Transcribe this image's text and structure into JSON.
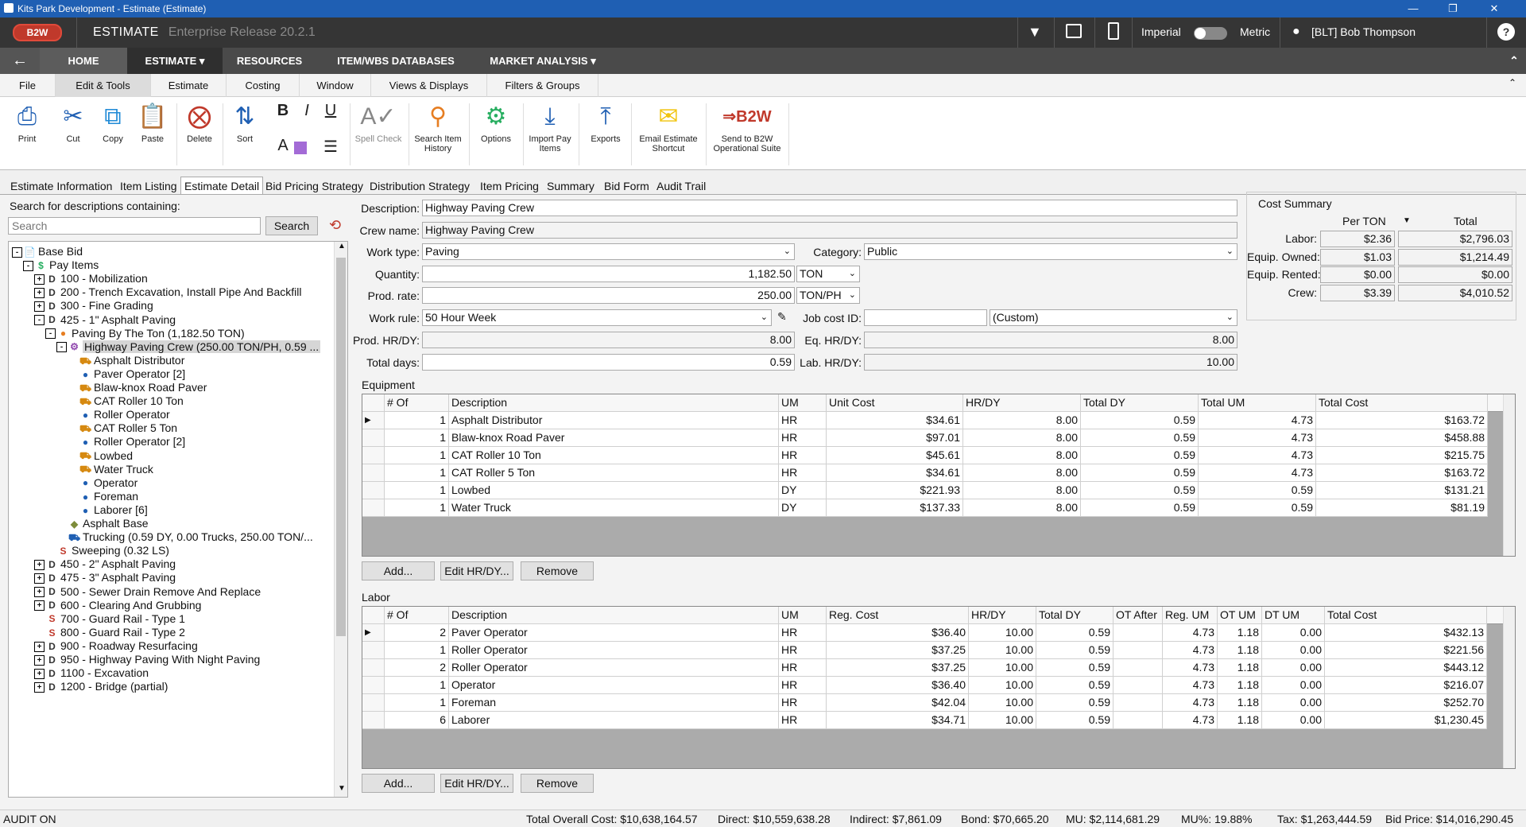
{
  "window": {
    "title": "Kits Park Development - Estimate (Estimate)"
  },
  "appbar": {
    "logo": "B2W",
    "app_name": "ESTIMATE",
    "release": "Enterprise Release 20.2.1",
    "imperial": "Imperial",
    "metric": "Metric",
    "user": "[BLT] Bob Thompson",
    "help": "?"
  },
  "mainnav": {
    "home": "HOME",
    "estimate": "ESTIMATE",
    "resources": "RESOURCES",
    "item_wbs": "ITEM/WBS DATABASES",
    "market": "MARKET ANALYSIS"
  },
  "ribbon_tabs": [
    "File",
    "Edit & Tools",
    "Estimate",
    "Costing",
    "Window",
    "Views & Displays",
    "Filters & Groups"
  ],
  "ribbon": {
    "print": "Print",
    "cut": "Cut",
    "copy": "Copy",
    "paste": "Paste",
    "delete": "Delete",
    "sort": "Sort",
    "bold": "B",
    "italic": "I",
    "underline": "U",
    "font_a": "A",
    "spell": "Spell Check",
    "search_hist": "Search Item History",
    "options": "Options",
    "import_pay": "Import Pay Items",
    "exports": "Exports",
    "email": "Email Estimate Shortcut",
    "send": "Send to B2W Operational Suite"
  },
  "content_tabs": [
    "Estimate Information",
    "Item Listing",
    "Estimate Detail",
    "Bid Pricing Strategy",
    "Distribution Strategy",
    "Item Pricing",
    "Summary",
    "Bid Form",
    "Audit Trail"
  ],
  "search": {
    "label": "Search for descriptions containing:",
    "placeholder": "Search",
    "button": "Search"
  },
  "tree": [
    {
      "t": "Base Bid",
      "lvl": 0,
      "box": "-",
      "icon": "doc"
    },
    {
      "t": "Pay Items",
      "lvl": 1,
      "box": "-",
      "icon": "$"
    },
    {
      "t": "100 - Mobilization",
      "lvl": 2,
      "box": "+",
      "icon": "D"
    },
    {
      "t": "200 - Trench Excavation, Install Pipe And Backfill",
      "lvl": 2,
      "box": "+",
      "icon": "D"
    },
    {
      "t": "300 - Fine Grading",
      "lvl": 2,
      "box": "+",
      "icon": "D"
    },
    {
      "t": "425 - 1\" Asphalt Paving",
      "lvl": 2,
      "box": "-",
      "icon": "D"
    },
    {
      "t": "Paving By The Ton (1,182.50 TON)",
      "lvl": 3,
      "box": "-",
      "icon": "O"
    },
    {
      "t": "Highway Paving Crew (250.00 TON/PH, 0.59 ...",
      "lvl": 4,
      "box": "-",
      "icon": "crew",
      "sel": true
    },
    {
      "t": "Asphalt Distributor",
      "lvl": 5,
      "icon": "eq"
    },
    {
      "t": "Paver Operator [2]",
      "lvl": 5,
      "icon": "per"
    },
    {
      "t": "Blaw-knox Road Paver",
      "lvl": 5,
      "icon": "eq"
    },
    {
      "t": "CAT Roller 10 Ton",
      "lvl": 5,
      "icon": "eq"
    },
    {
      "t": "Roller Operator",
      "lvl": 5,
      "icon": "per"
    },
    {
      "t": "CAT Roller 5 Ton",
      "lvl": 5,
      "icon": "eq"
    },
    {
      "t": "Roller Operator [2]",
      "lvl": 5,
      "icon": "per"
    },
    {
      "t": "Lowbed",
      "lvl": 5,
      "icon": "eq"
    },
    {
      "t": "Water Truck",
      "lvl": 5,
      "icon": "eq"
    },
    {
      "t": "Operator",
      "lvl": 5,
      "icon": "per"
    },
    {
      "t": "Foreman",
      "lvl": 5,
      "icon": "per"
    },
    {
      "t": "Laborer [6]",
      "lvl": 5,
      "icon": "per"
    },
    {
      "t": "Asphalt Base",
      "lvl": 4,
      "icon": "mat"
    },
    {
      "t": "Trucking (0.59 DY, 0.00 Trucks, 250.00 TON/...",
      "lvl": 4,
      "icon": "trk"
    },
    {
      "t": "Sweeping (0.32 LS)",
      "lvl": 3,
      "icon": "S"
    },
    {
      "t": "450 - 2\" Asphalt Paving",
      "lvl": 2,
      "box": "+",
      "icon": "D"
    },
    {
      "t": "475 - 3\" Asphalt Paving",
      "lvl": 2,
      "box": "+",
      "icon": "D"
    },
    {
      "t": "500 - Sewer Drain Remove And Replace",
      "lvl": 2,
      "box": "+",
      "icon": "D"
    },
    {
      "t": "600 - Clearing And Grubbing",
      "lvl": 2,
      "box": "+",
      "icon": "D"
    },
    {
      "t": "700 - Guard Rail - Type 1",
      "lvl": 2,
      "icon": "S"
    },
    {
      "t": "800 - Guard Rail - Type 2",
      "lvl": 2,
      "icon": "S"
    },
    {
      "t": "900 - Roadway Resurfacing",
      "lvl": 2,
      "box": "+",
      "icon": "D"
    },
    {
      "t": "950 - Highway Paving With Night Paving",
      "lvl": 2,
      "box": "+",
      "icon": "D"
    },
    {
      "t": "1100 - Excavation",
      "lvl": 2,
      "box": "+",
      "icon": "D"
    },
    {
      "t": "1200 - Bridge (partial)",
      "lvl": 2,
      "box": "+",
      "icon": "D"
    }
  ],
  "form": {
    "description_label": "Description:",
    "description": "Highway Paving Crew",
    "crew_label": "Crew name:",
    "crew": "Highway Paving Crew",
    "worktype_label": "Work type:",
    "worktype": "Paving",
    "category_label": "Category:",
    "category": "Public",
    "quantity_label": "Quantity:",
    "quantity": "1,182.50",
    "quantity_um": "TON",
    "prodrate_label": "Prod. rate:",
    "prodrate": "250.00",
    "prodrate_um": "TON/PH",
    "workrule_label": "Work rule:",
    "workrule": "50 Hour Week",
    "jobcost_label": "Job cost ID:",
    "jobcost": "",
    "jobcost_sel": "(Custom)",
    "prodhr_label": "Prod. HR/DY:",
    "prodhr": "8.00",
    "eqhr_label": "Eq. HR/DY:",
    "eqhr": "8.00",
    "totaldays_label": "Total days:",
    "totaldays": "0.59",
    "labhr_label": "Lab. HR/DY:",
    "labhr": "10.00"
  },
  "cost_summary": {
    "title": "Cost Summary",
    "col1": "Per TON",
    "col2": "Total",
    "rows": [
      {
        "label": "Labor:",
        "per": "$2.36",
        "total": "$2,796.03"
      },
      {
        "label": "Equip. Owned:",
        "per": "$1.03",
        "total": "$1,214.49"
      },
      {
        "label": "Equip. Rented:",
        "per": "$0.00",
        "total": "$0.00"
      },
      {
        "label": "Crew:",
        "per": "$3.39",
        "total": "$4,010.52"
      }
    ]
  },
  "equipment": {
    "title": "Equipment",
    "headers": [
      "# Of",
      "Description",
      "UM",
      "Unit Cost",
      "HR/DY",
      "Total DY",
      "Total UM",
      "Total Cost"
    ],
    "rows": [
      [
        "1",
        "Asphalt Distributor",
        "HR",
        "$34.61",
        "8.00",
        "0.59",
        "4.73",
        "$163.72"
      ],
      [
        "1",
        "Blaw-knox Road Paver",
        "HR",
        "$97.01",
        "8.00",
        "0.59",
        "4.73",
        "$458.88"
      ],
      [
        "1",
        "CAT Roller 10 Ton",
        "HR",
        "$45.61",
        "8.00",
        "0.59",
        "4.73",
        "$215.75"
      ],
      [
        "1",
        "CAT Roller 5 Ton",
        "HR",
        "$34.61",
        "8.00",
        "0.59",
        "4.73",
        "$163.72"
      ],
      [
        "1",
        "Lowbed",
        "DY",
        "$221.93",
        "8.00",
        "0.59",
        "0.59",
        "$131.21"
      ],
      [
        "1",
        "Water Truck",
        "DY",
        "$137.33",
        "8.00",
        "0.59",
        "0.59",
        "$81.19"
      ]
    ],
    "add": "Add...",
    "edit": "Edit HR/DY...",
    "remove": "Remove"
  },
  "labor": {
    "title": "Labor",
    "headers": [
      "# Of",
      "Description",
      "UM",
      "Reg. Cost",
      "HR/DY",
      "Total DY",
      "OT After",
      "Reg. UM",
      "OT UM",
      "DT UM",
      "Total Cost"
    ],
    "rows": [
      [
        "2",
        "Paver Operator",
        "HR",
        "$36.40",
        "10.00",
        "0.59",
        "",
        "4.73",
        "1.18",
        "0.00",
        "$432.13"
      ],
      [
        "1",
        "Roller Operator",
        "HR",
        "$37.25",
        "10.00",
        "0.59",
        "",
        "4.73",
        "1.18",
        "0.00",
        "$221.56"
      ],
      [
        "2",
        "Roller Operator",
        "HR",
        "$37.25",
        "10.00",
        "0.59",
        "",
        "4.73",
        "1.18",
        "0.00",
        "$443.12"
      ],
      [
        "1",
        "Operator",
        "HR",
        "$36.40",
        "10.00",
        "0.59",
        "",
        "4.73",
        "1.18",
        "0.00",
        "$216.07"
      ],
      [
        "1",
        "Foreman",
        "HR",
        "$42.04",
        "10.00",
        "0.59",
        "",
        "4.73",
        "1.18",
        "0.00",
        "$252.70"
      ],
      [
        "6",
        "Laborer",
        "HR",
        "$34.71",
        "10.00",
        "0.59",
        "",
        "4.73",
        "1.18",
        "0.00",
        "$1,230.45"
      ]
    ],
    "add": "Add...",
    "edit": "Edit HR/DY...",
    "remove": "Remove"
  },
  "status": {
    "audit": "AUDIT ON",
    "total_overall": "Total Overall Cost: $10,638,164.57",
    "direct": "Direct: $10,559,638.28",
    "indirect": "Indirect: $7,861.09",
    "bond": "Bond: $70,665.20",
    "mu": "MU: $2,114,681.29",
    "mupct": "MU%: 19.88%",
    "tax": "Tax: $1,263,444.59",
    "bidprice": "Bid Price: $14,016,290.45"
  }
}
